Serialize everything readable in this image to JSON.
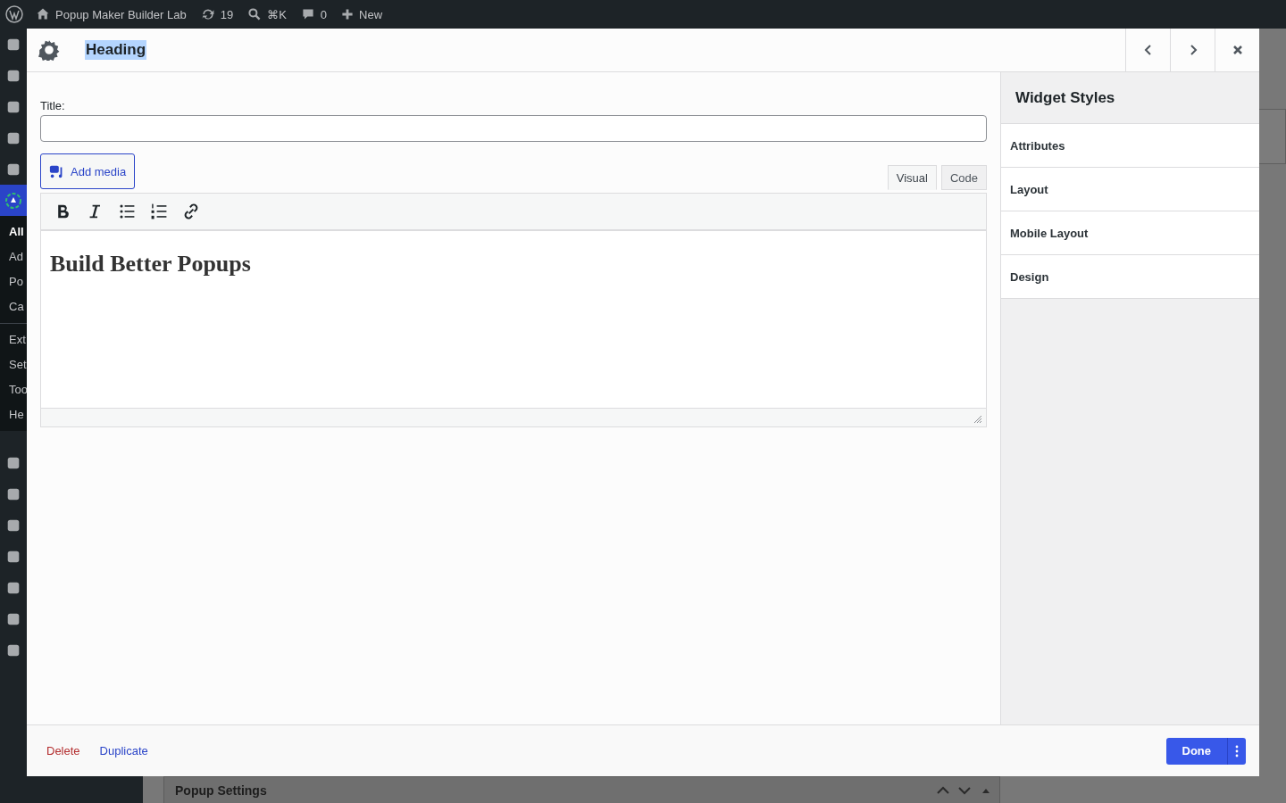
{
  "admin_bar": {
    "site_name": "Popup Maker Builder Lab",
    "updates": "19",
    "search_shortcut": "⌘K",
    "comments": "0",
    "new_label": "New"
  },
  "sidebar": {
    "submenu": [
      {
        "label": "All",
        "selected": true
      },
      {
        "label": "Ad",
        "selected": false
      },
      {
        "label": "Po",
        "selected": false
      },
      {
        "label": "Ca",
        "selected": false
      }
    ],
    "submenu_extra": [
      {
        "label": "Ext",
        "selected": false
      },
      {
        "label": "Set",
        "selected": false
      },
      {
        "label": "Too",
        "selected": false
      },
      {
        "label": "He",
        "selected": false
      }
    ]
  },
  "modal": {
    "title": "Heading",
    "title_highlighted": true
  },
  "editor": {
    "title_label": "Title:",
    "add_media": "Add media",
    "tabs": [
      {
        "label": "Visual",
        "selected": true
      },
      {
        "label": "Code",
        "selected": false
      }
    ],
    "content_heading": "Build Better Popups"
  },
  "styles_panel": {
    "title": "Widget Styles",
    "items": [
      "Attributes",
      "Layout",
      "Mobile Layout",
      "Design"
    ]
  },
  "footer": {
    "delete": "Delete",
    "duplicate": "Duplicate",
    "done": "Done"
  },
  "background": {
    "panel_title": "Popup Settings"
  }
}
